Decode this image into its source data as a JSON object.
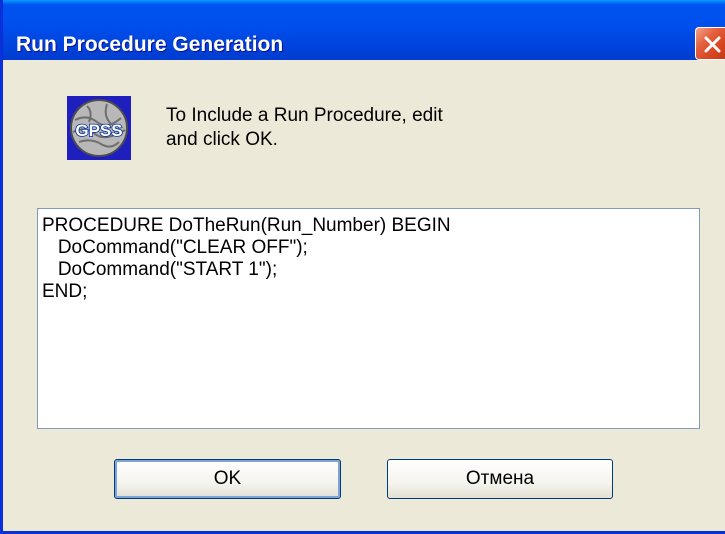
{
  "window": {
    "title": "Run Procedure Generation"
  },
  "icon": {
    "text": "GPSS"
  },
  "prompt": {
    "line1": "To Include a Run Procedure, edit",
    "line2": "and click OK."
  },
  "editor": {
    "value": "PROCEDURE DoTheRun(Run_Number) BEGIN\n   DoCommand(\"CLEAR OFF\");\n   DoCommand(\"START 1\");\nEND;"
  },
  "buttons": {
    "ok_label": "OK",
    "cancel_label": "Отмена"
  },
  "colors": {
    "titlebar": "#0054e3",
    "window_face": "#ece9d8",
    "close": "#d5431f"
  }
}
